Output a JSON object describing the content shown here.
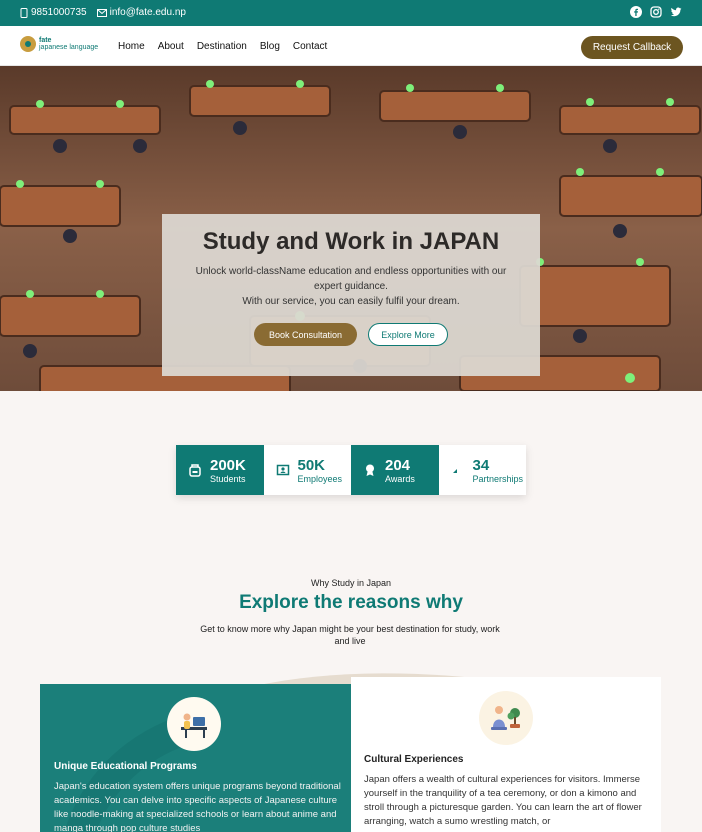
{
  "topbar": {
    "phone": "9851000735",
    "email": "info@fate.edu.np",
    "social": [
      "facebook-icon",
      "instagram-icon",
      "twitter-icon"
    ]
  },
  "nav": {
    "logo_line1": "fate",
    "logo_line2": "japanese language",
    "items": [
      {
        "label": "Home"
      },
      {
        "label": "About"
      },
      {
        "label": "Destination"
      },
      {
        "label": "Blog"
      },
      {
        "label": "Contact"
      }
    ],
    "cta": "Request Callback"
  },
  "hero": {
    "title": "Study and Work in JAPAN",
    "text1": "Unlock world-className education and endless opportunities with our expert guidance.",
    "text2": "With our service, you can easily fulfil your dream.",
    "btn_primary": "Book Consultation",
    "btn_secondary": "Explore More"
  },
  "stats": [
    {
      "value": "200K",
      "label": "Students",
      "icon": "graduation-icon"
    },
    {
      "value": "50K",
      "label": "Employees",
      "icon": "id-card-icon"
    },
    {
      "value": "204",
      "label": "Awards",
      "icon": "award-icon"
    },
    {
      "value": "34",
      "label": "Partnerships",
      "icon": "handshake-icon"
    }
  ],
  "why": {
    "eyebrow": "Why Study in Japan",
    "title": "Explore the reasons why",
    "subtitle": "Get to know more why Japan might be your best destination for study, work and live"
  },
  "cards": [
    {
      "title": "Unique Educational Programs",
      "text": "Japan's education system offers unique programs beyond traditional academics. You can delve into specific aspects of Japanese culture like noodle-making at specialized schools or learn about anime and manga through pop culture studies"
    },
    {
      "title": "Cultural Experiences",
      "text": "Japan offers a wealth of cultural experiences for visitors. Immerse yourself in the tranquility of a tea ceremony, or don a kimono and stroll through a picturesque garden. You can learn the art of flower arranging, watch a sumo wrestling match, or"
    }
  ],
  "colors": {
    "teal": "#0f7a74",
    "brown": "#6c5520",
    "gold": "#8a6b33",
    "background": "#f9f5f3"
  }
}
